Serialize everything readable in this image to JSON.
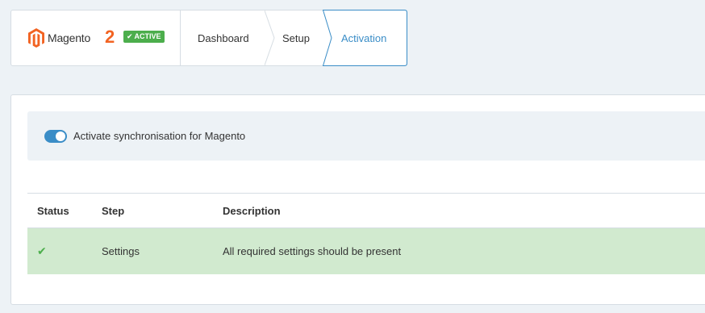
{
  "header": {
    "brand": {
      "name": "Magento",
      "version": "2",
      "badge": "ACTIVE",
      "logo_icon": "magento-logo-icon",
      "logo_color": "#f26322"
    },
    "breadcrumbs": [
      {
        "label": "Dashboard",
        "active": false
      },
      {
        "label": "Setup",
        "active": false
      },
      {
        "label": "Activation",
        "active": true
      }
    ]
  },
  "sync": {
    "label": "Activate synchronisation for Magento",
    "enabled": true
  },
  "table": {
    "columns": [
      "Status",
      "Step",
      "Description"
    ],
    "rows": [
      {
        "status_icon": "check-icon",
        "step": "Settings",
        "description": "All required settings should be present"
      }
    ]
  },
  "colors": {
    "accent": "#3a8dc7",
    "success": "#4cae4c",
    "success_row_bg": "#d1eacf",
    "page_bg": "#edf2f6"
  }
}
